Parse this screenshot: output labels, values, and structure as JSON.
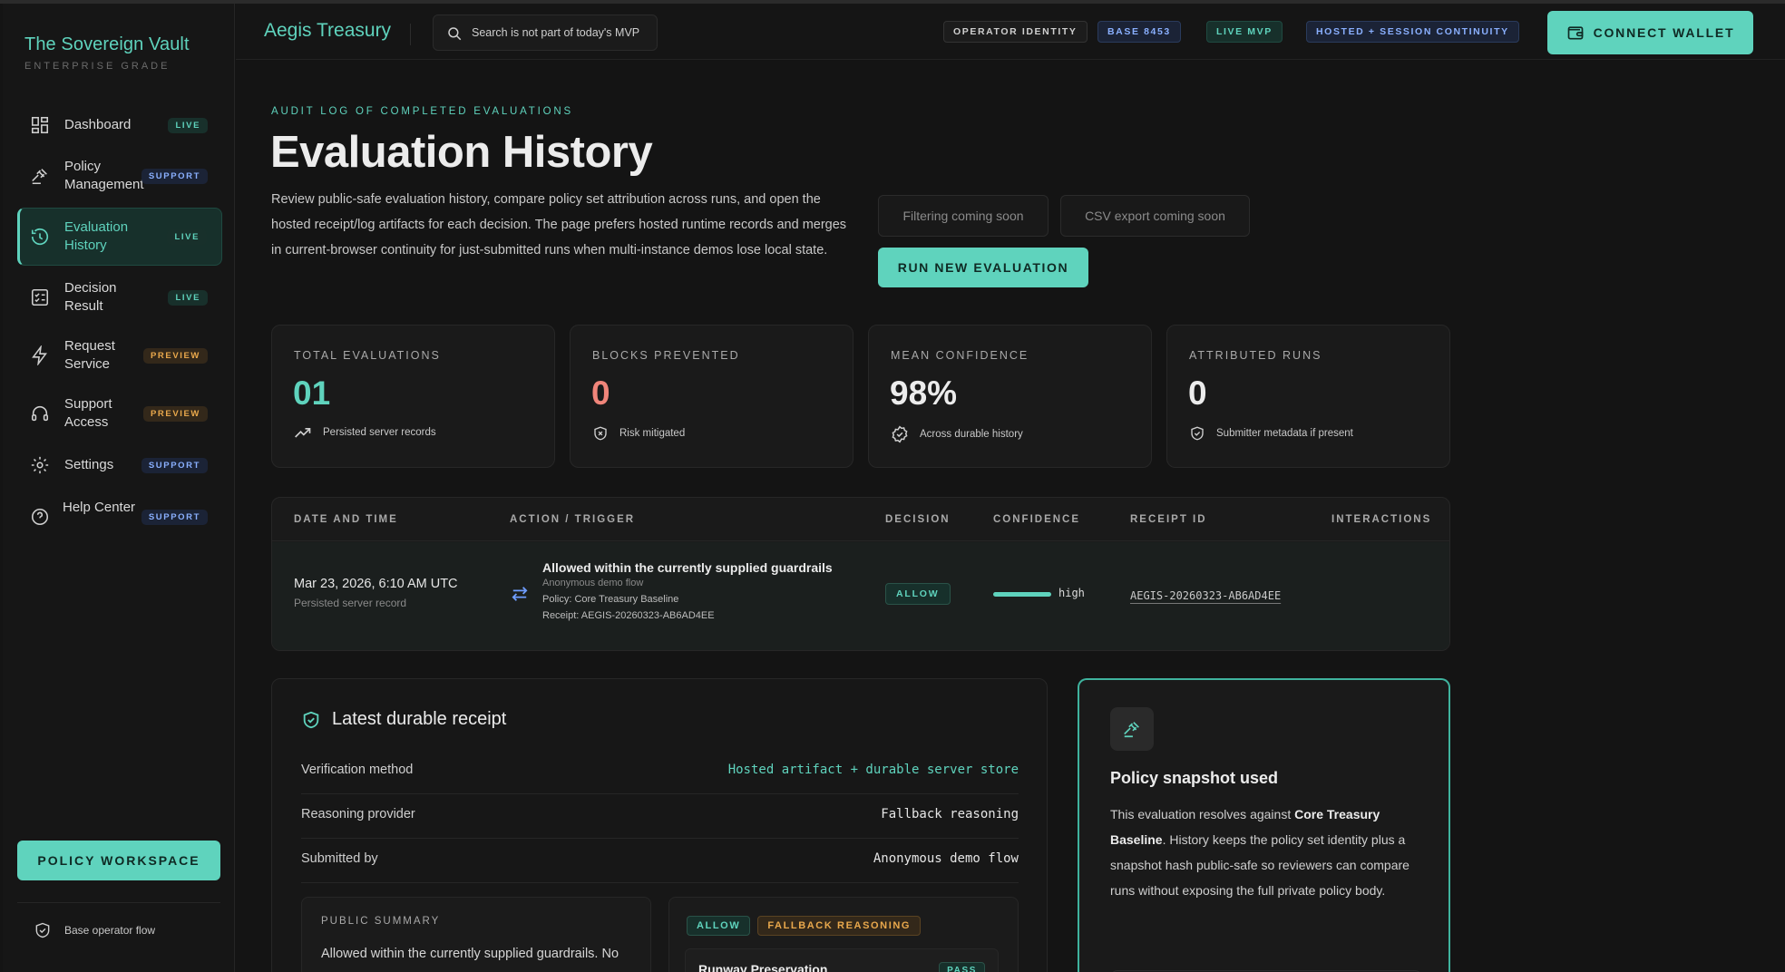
{
  "brand": {
    "title": "The Sovereign Vault",
    "subtitle": "ENTERPRISE GRADE"
  },
  "sidebar": {
    "items": [
      {
        "label": "Dashboard",
        "badge": "LIVE",
        "icon": "dashboard-grid-icon"
      },
      {
        "label": "Policy Management",
        "badge": "SUPPORT",
        "icon": "gavel-icon"
      },
      {
        "label": "Evaluation History",
        "badge": "LIVE",
        "icon": "history-icon",
        "active": true
      },
      {
        "label": "Decision Result",
        "badge": "LIVE",
        "icon": "checklist-icon"
      },
      {
        "label": "Request Service",
        "badge": "PREVIEW",
        "icon": "bolt-icon"
      },
      {
        "label": "Support Access",
        "badge": "PREVIEW",
        "icon": "headset-icon"
      },
      {
        "label": "Settings",
        "badge": "SUPPORT",
        "icon": "gear-icon"
      },
      {
        "label": "Help Center",
        "badge": "SUPPORT",
        "icon": "help-circle-icon"
      }
    ],
    "policy_button": "POLICY WORKSPACE",
    "footer": "Base operator flow"
  },
  "topbar": {
    "app_title": "Aegis Treasury",
    "search_placeholder": "Search is not part of today's MVP",
    "chips": [
      "OPERATOR IDENTITY",
      "BASE 8453",
      "LIVE MVP",
      "HOSTED + SESSION CONTINUITY"
    ],
    "connect_label": "CONNECT WALLET"
  },
  "header": {
    "eyebrow": "AUDIT LOG OF COMPLETED EVALUATIONS",
    "title": "Evaluation History",
    "description": "Review public-safe evaluation history, compare policy set attribution across runs, and open the hosted receipt/log artifacts for each decision. The page prefers hosted runtime records and merges in current-browser continuity for just-submitted runs when multi-instance demos lose local state.",
    "filter_label": "Filtering coming soon",
    "export_label": "CSV export coming soon",
    "run_label": "RUN NEW EVALUATION"
  },
  "stats": [
    {
      "label": "TOTAL EVALUATIONS",
      "value": "01",
      "foot": "Persisted server records",
      "color": "#5fd3bd"
    },
    {
      "label": "BLOCKS PREVENTED",
      "value": "0",
      "foot": "Risk mitigated",
      "color": "#f0857a"
    },
    {
      "label": "MEAN CONFIDENCE",
      "value": "98%",
      "foot": "Across durable history",
      "color": "#ececec"
    },
    {
      "label": "ATTRIBUTED RUNS",
      "value": "0",
      "foot": "Submitter metadata if present",
      "color": "#ececec"
    }
  ],
  "table": {
    "headers": [
      "DATE AND TIME",
      "ACTION / TRIGGER",
      "DECISION",
      "CONFIDENCE",
      "RECEIPT ID",
      "INTERACTIONS"
    ],
    "rows": [
      {
        "date": "Mar 23, 2026, 6:10 AM UTC",
        "date_sub": "Persisted server record",
        "action_title": "Allowed within the currently supplied guardrails",
        "action_sub": "Anonymous demo flow",
        "action_policy": "Policy: Core Treasury Baseline",
        "action_receipt": "Receipt: AEGIS-20260323-AB6AD4EE",
        "decision": "ALLOW",
        "confidence": "high",
        "receipt_id": "AEGIS-20260323-AB6AD4EE"
      }
    ]
  },
  "receipt": {
    "title": "Latest durable receipt",
    "rows": [
      {
        "key": "Verification method",
        "value": "Hosted artifact + durable server store"
      },
      {
        "key": "Reasoning provider",
        "value": "Fallback reasoning"
      },
      {
        "key": "Submitted by",
        "value": "Anonymous demo flow"
      }
    ],
    "public_summary_label": "PUBLIC SUMMARY",
    "public_summary": "Allowed within the currently supplied guardrails. No",
    "tags": [
      "ALLOW",
      "FALLBACK REASONING"
    ],
    "check_name": "Runway Preservation",
    "check_status": "PASS"
  },
  "policy_snapshot": {
    "title": "Policy snapshot used",
    "text_before": "This evaluation resolves against ",
    "policy_name": "Core Treasury Baseline",
    "text_after": ". History keeps the policy set identity plus a snapshot hash public-safe so reviewers can compare runs without exposing the full private policy body."
  }
}
